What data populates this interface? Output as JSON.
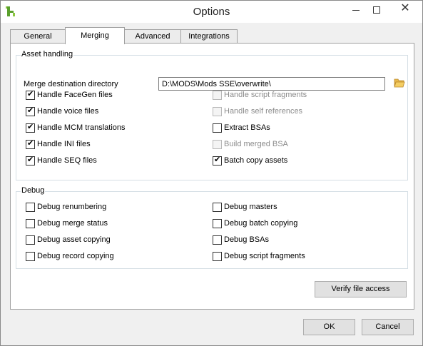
{
  "window": {
    "title": "Options",
    "close_glyph": "✕"
  },
  "tabs": [
    {
      "label": "General"
    },
    {
      "label": "Merging"
    },
    {
      "label": "Advanced"
    },
    {
      "label": "Integrations"
    }
  ],
  "asset_handling": {
    "legend": "Asset handling",
    "merge_dir_label": "Merge destination directory",
    "merge_dir_value": "D:\\MODS\\Mods SSE\\overwrite\\",
    "options": [
      {
        "label": "Handle FaceGen files",
        "checked": true,
        "disabled": false
      },
      {
        "label": "Handle script fragments",
        "checked": false,
        "disabled": true
      },
      {
        "label": "Handle voice files",
        "checked": true,
        "disabled": false
      },
      {
        "label": "Handle self references",
        "checked": false,
        "disabled": true
      },
      {
        "label": "Handle MCM translations",
        "checked": true,
        "disabled": false
      },
      {
        "label": "Extract BSAs",
        "checked": false,
        "disabled": false
      },
      {
        "label": "Handle INI files",
        "checked": true,
        "disabled": false
      },
      {
        "label": "Build merged BSA",
        "checked": false,
        "disabled": true
      },
      {
        "label": "Handle SEQ files",
        "checked": true,
        "disabled": false
      },
      {
        "label": "Batch copy assets",
        "checked": true,
        "disabled": false
      }
    ]
  },
  "debug": {
    "legend": "Debug",
    "options": [
      {
        "label": "Debug renumbering",
        "checked": false,
        "disabled": false
      },
      {
        "label": "Debug masters",
        "checked": false,
        "disabled": false
      },
      {
        "label": "Debug merge status",
        "checked": false,
        "disabled": false
      },
      {
        "label": "Debug batch copying",
        "checked": false,
        "disabled": false
      },
      {
        "label": "Debug asset copying",
        "checked": false,
        "disabled": false
      },
      {
        "label": "Debug BSAs",
        "checked": false,
        "disabled": false
      },
      {
        "label": "Debug record copying",
        "checked": false,
        "disabled": false
      },
      {
        "label": "Debug script fragments",
        "checked": false,
        "disabled": false
      }
    ]
  },
  "buttons": {
    "verify": "Verify file access",
    "ok": "OK",
    "cancel": "Cancel"
  }
}
